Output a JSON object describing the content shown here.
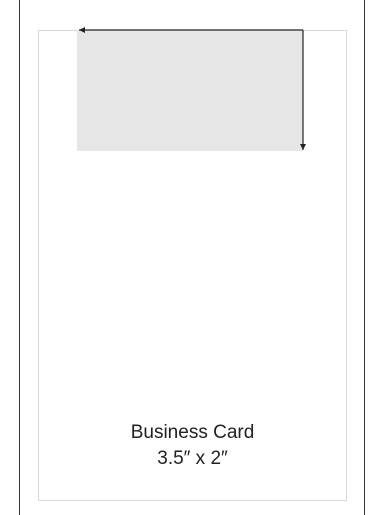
{
  "caption": {
    "line1": "Business Card",
    "line2": "3.5″ x 2″"
  },
  "colors": {
    "frame": "#333333",
    "sheet_border": "#d9d9d9",
    "card_fill": "#e6e6e6",
    "arrow": "#222222"
  }
}
